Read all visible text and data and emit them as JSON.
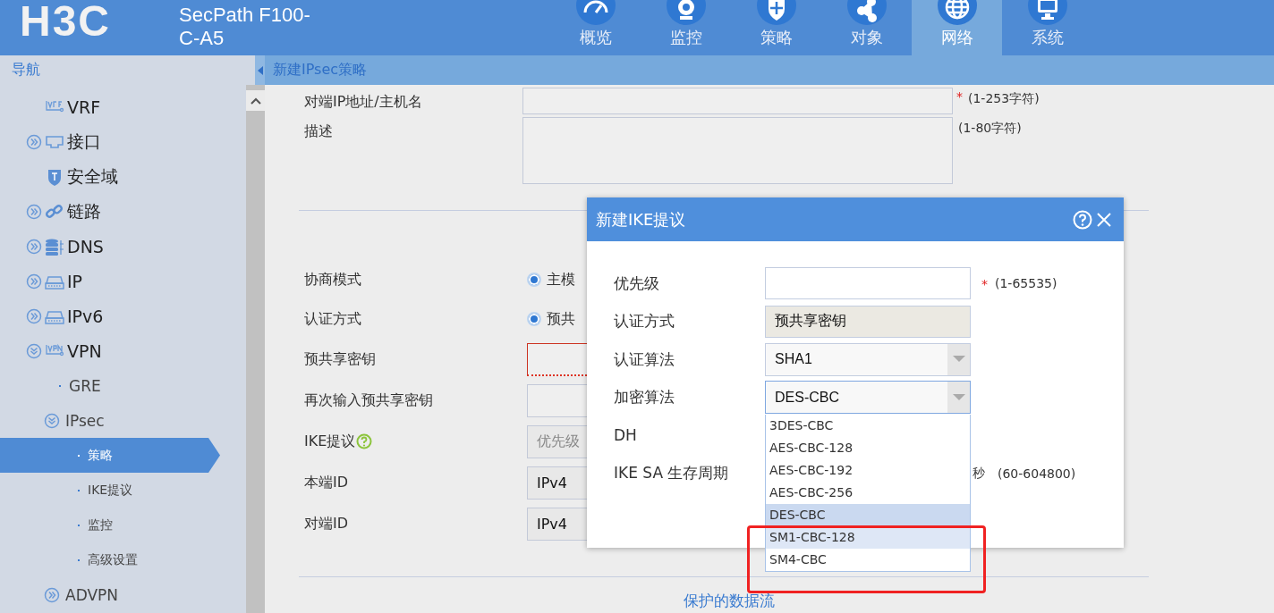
{
  "header": {
    "logo": "H3C",
    "product": "SecPath F100-C-A5",
    "tabs": [
      {
        "label": "概览",
        "selected": false
      },
      {
        "label": "监控",
        "selected": false
      },
      {
        "label": "策略",
        "selected": false
      },
      {
        "label": "对象",
        "selected": false
      },
      {
        "label": "网络",
        "selected": true
      },
      {
        "label": "系统",
        "selected": false
      }
    ]
  },
  "nav": {
    "title": "导航",
    "items": [
      {
        "label": "VRF",
        "kind": "leaf",
        "selected": false
      },
      {
        "label": "接口",
        "kind": "group",
        "expanded": false,
        "selected": false
      },
      {
        "label": "安全域",
        "kind": "leaf",
        "selected": false
      },
      {
        "label": "链路",
        "kind": "group",
        "expanded": false,
        "selected": false
      },
      {
        "label": "DNS",
        "kind": "group",
        "expanded": false,
        "selected": false
      },
      {
        "label": "IP",
        "kind": "group",
        "expanded": false,
        "selected": false
      },
      {
        "label": "IPv6",
        "kind": "group",
        "expanded": false,
        "selected": false
      },
      {
        "label": "VPN",
        "kind": "group",
        "expanded": true,
        "selected": false,
        "children": [
          {
            "label": "GRE",
            "kind": "leaf",
            "selected": false
          },
          {
            "label": "IPsec",
            "kind": "group",
            "expanded": true,
            "selected": false,
            "children": [
              {
                "label": "策略",
                "kind": "leaf",
                "selected": true
              },
              {
                "label": "IKE提议",
                "kind": "leaf",
                "selected": false
              },
              {
                "label": "监控",
                "kind": "leaf",
                "selected": false
              },
              {
                "label": "高级设置",
                "kind": "leaf",
                "selected": false
              }
            ]
          },
          {
            "label": "ADVPN",
            "kind": "group",
            "expanded": false,
            "selected": false
          }
        ]
      }
    ]
  },
  "page_title": "新建IPsec策略",
  "form": {
    "top_rows": [
      {
        "kind": "input",
        "label": "对端IP地址/主机名",
        "required_mark": "*",
        "note": "(1-253字符)"
      },
      {
        "kind": "textarea",
        "label": "描述",
        "note": "(1-80字符)"
      }
    ],
    "ike_rows": [
      {
        "kind": "radio",
        "label": "协商模式",
        "option": "主模",
        "checked": true
      },
      {
        "kind": "radio",
        "label": "认证方式",
        "option": "预共",
        "checked": true
      },
      {
        "kind": "input",
        "label": "预共享密钥",
        "error": true
      },
      {
        "kind": "input",
        "label": "再次输入预共享密钥",
        "error": false
      },
      {
        "kind": "proposal",
        "label": "IKE提议",
        "placeholder": "优先级"
      },
      {
        "kind": "select",
        "label": "本端ID",
        "value": "IPv4"
      },
      {
        "kind": "select",
        "label": "对端ID",
        "value": "IPv4"
      }
    ],
    "link": "保护的数据流"
  },
  "dialog": {
    "title": "新建IKE提议",
    "rows": [
      {
        "kind": "input",
        "label": "优先级",
        "required_mark": "*",
        "note": "(1-65535)"
      },
      {
        "kind": "readonly",
        "label": "认证方式",
        "value": "预共享密钥"
      },
      {
        "kind": "select",
        "label": "认证算法",
        "value": "SHA1",
        "expanded": false
      },
      {
        "kind": "select",
        "label": "加密算法",
        "value": "DES-CBC",
        "expanded": true,
        "options": [
          {
            "label": "3DES-CBC",
            "selected": false,
            "hovered": false
          },
          {
            "label": "AES-CBC-128",
            "selected": false,
            "hovered": false
          },
          {
            "label": "AES-CBC-192",
            "selected": false,
            "hovered": false
          },
          {
            "label": "AES-CBC-256",
            "selected": false,
            "hovered": false
          },
          {
            "label": "DES-CBC",
            "selected": true,
            "hovered": false
          },
          {
            "label": "SM1-CBC-128",
            "selected": false,
            "hovered": true
          },
          {
            "label": "SM4-CBC",
            "selected": false,
            "hovered": false
          }
        ]
      },
      {
        "kind": "covered",
        "label": "DH"
      },
      {
        "kind": "covered",
        "label": "IKE SA 生存周期",
        "unit": "秒",
        "note": "(60-604800)"
      }
    ]
  }
}
